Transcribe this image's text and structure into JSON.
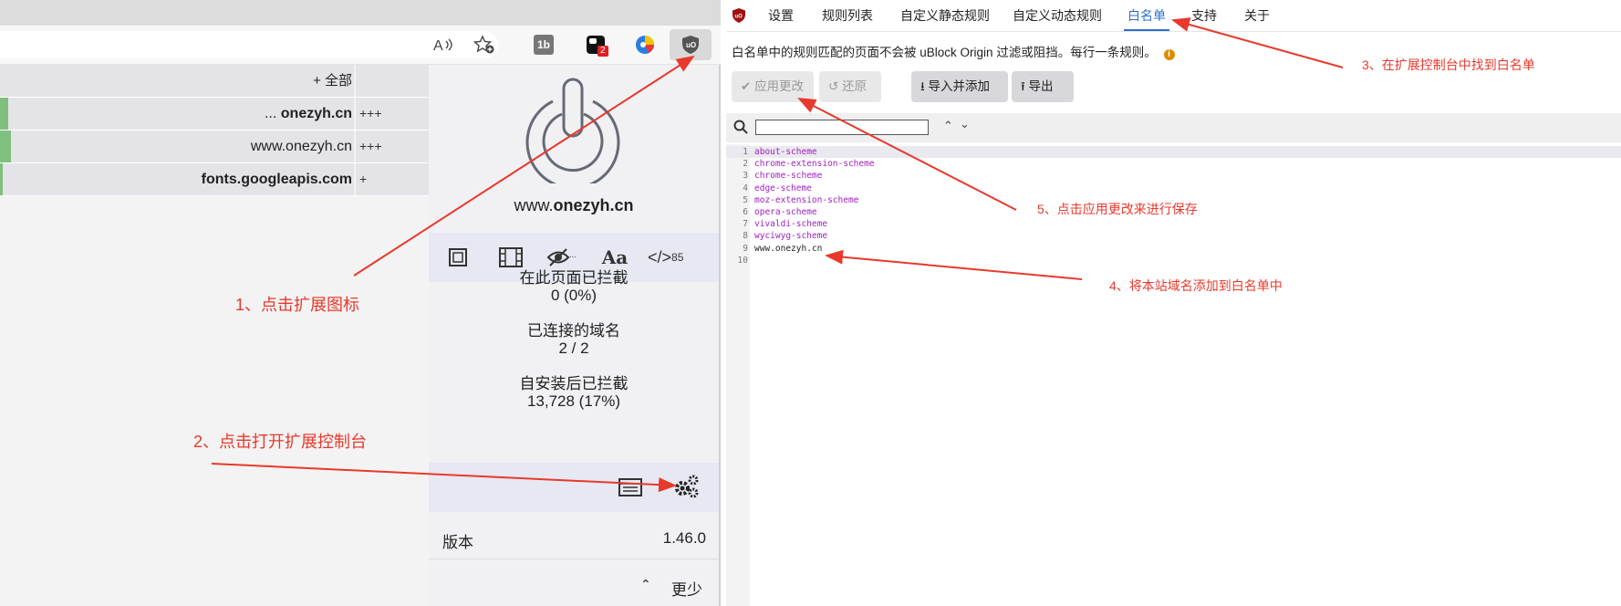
{
  "browser": {
    "toolbar_icons": [
      "read-aloud-icon",
      "favorite-add-icon",
      "extension-1b-icon",
      "extension-badge-icon",
      "extension-colorful-icon",
      "ublock-icon"
    ],
    "extension_1b_label": "1b",
    "badge_count": "2",
    "domain_list": {
      "header": "+ 全部",
      "rows": [
        {
          "prefix": "... ",
          "domain": "onezyh.cn",
          "bold": true,
          "count": "+++",
          "bar": 0.02
        },
        {
          "prefix": "",
          "domain": "www.onezyh.cn",
          "bold": false,
          "count": "+++",
          "bar": 0.025
        },
        {
          "prefix": "",
          "domain": "fonts.googleapis.com",
          "bold": true,
          "count": "+",
          "bar": 0.005
        }
      ]
    },
    "popup": {
      "hostname_prefix": "www.",
      "hostname_domain": "onezyh.cn",
      "tools": [
        "element-zapper-icon",
        "media-icon",
        "cosmetic-filter-icon",
        "font-icon",
        "javascript-icon"
      ],
      "font_tool_label": "Aa",
      "js_tool_label": "</>",
      "js_superscript": "85",
      "stats": [
        {
          "label": "在此页面已拦截",
          "value": "0 (0%)"
        },
        {
          "label": "已连接的域名",
          "value": "2 / 2"
        },
        {
          "label": "自安装后已拦截",
          "value": "13,728 (17%)"
        }
      ],
      "version_label": "版本",
      "version_value": "1.46.0",
      "less_label": "更少"
    }
  },
  "dashboard": {
    "tabs": [
      {
        "label": "设置",
        "active": false
      },
      {
        "label": "规则列表",
        "active": false
      },
      {
        "label": "自定义静态规则",
        "active": false
      },
      {
        "label": "自定义动态规则",
        "active": false
      },
      {
        "label": "白名单",
        "active": true
      },
      {
        "label": "支持",
        "active": false
      },
      {
        "label": "关于",
        "active": false
      }
    ],
    "description": "白名单中的规则匹配的页面不会被 uBlock Origin 过滤或阻挡。每行一条规则。",
    "buttons": {
      "apply": "应用更改",
      "revert": "还原",
      "import": "导入并添加",
      "export": "导出"
    },
    "search": {
      "value": ""
    },
    "editor_lines": [
      {
        "n": "1",
        "text": "about-scheme",
        "scheme": true
      },
      {
        "n": "2",
        "text": "chrome-extension-scheme",
        "scheme": true
      },
      {
        "n": "3",
        "text": "chrome-scheme",
        "scheme": true
      },
      {
        "n": "4",
        "text": "edge-scheme",
        "scheme": true
      },
      {
        "n": "5",
        "text": "moz-extension-scheme",
        "scheme": true
      },
      {
        "n": "6",
        "text": "opera-scheme",
        "scheme": true
      },
      {
        "n": "7",
        "text": "vivaldi-scheme",
        "scheme": true
      },
      {
        "n": "8",
        "text": "wyciwyg-scheme",
        "scheme": true
      },
      {
        "n": "9",
        "text": "www.onezyh.cn",
        "scheme": false
      },
      {
        "n": "10",
        "text": "",
        "scheme": false
      }
    ]
  },
  "annotations": {
    "step1": "1、点击扩展图标",
    "step2": "2、点击打开扩展控制台",
    "step3": "3、在扩展控制台中找到白名单",
    "step4": "4、将本站域名添加到白名单中",
    "step5": "5、点击应用更改来进行保存"
  },
  "colors": {
    "accent": "#2b6fd1",
    "annotation": "#e8392c",
    "scheme_text": "#a020c0",
    "block_bar": "#7fc07f"
  }
}
